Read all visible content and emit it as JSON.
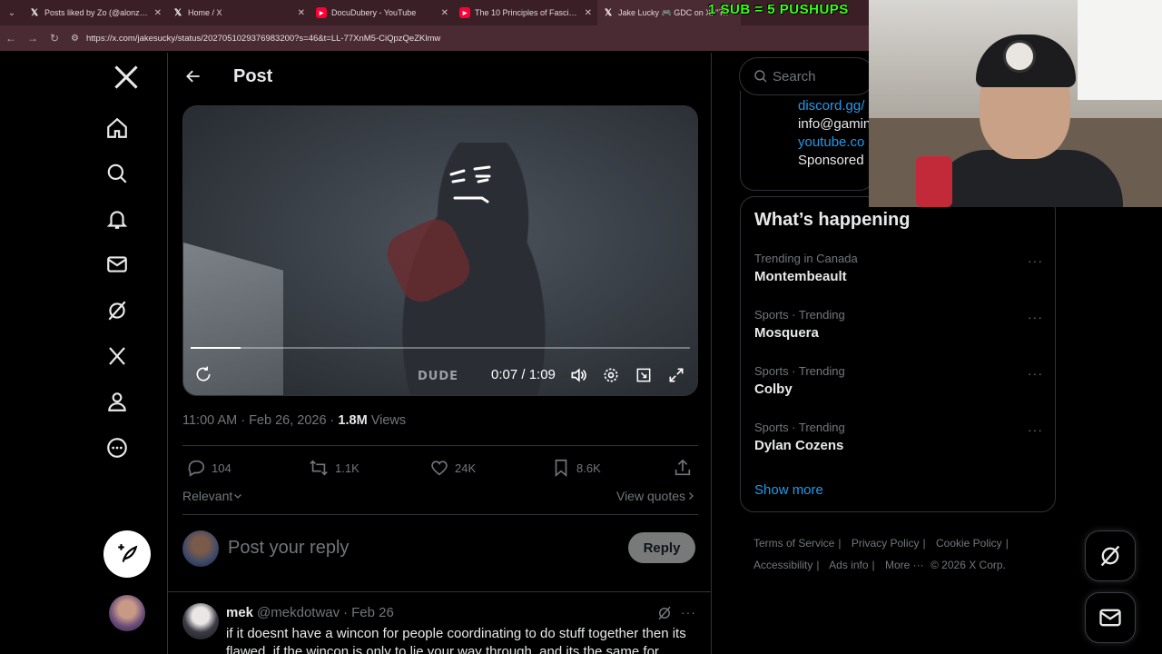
{
  "browser": {
    "tabs": [
      {
        "title": "Posts liked by Zo (@alonzonem",
        "favicon": "x-icon",
        "active": false
      },
      {
        "title": "Home / X",
        "favicon": "x-icon",
        "active": false
      },
      {
        "title": "DocuDubery - YouTube",
        "favicon": "youtube-icon",
        "active": false
      },
      {
        "title": "The 10 Principles of Fascism U",
        "favicon": "youtube-icon",
        "active": false
      },
      {
        "title": "Jake Lucky 🎮 GDC on X: \"Th",
        "favicon": "x-icon",
        "active": true
      }
    ],
    "url": "https://x.com/jakesucky/status/2027051029376983200?s=46&t=LL-77XnM5-CiQpzQeZKlmw",
    "stream_overlay": "1 SUB = 5 PUSHUPS"
  },
  "header": {
    "title": "Post"
  },
  "video": {
    "brand": "DUDE",
    "time": "0:07 / 1:09",
    "progress_fraction": 0.1
  },
  "post": {
    "meta_time": "11:00 AM · Feb 26, 2026 · ",
    "views_count": "1.8M",
    "views_label": " Views",
    "replies": "104",
    "reposts": "1.1K",
    "likes": "24K",
    "bookmarks": "8.6K",
    "sort_label": "Relevant",
    "view_quotes": "View quotes"
  },
  "reply": {
    "placeholder": "Post your reply",
    "button": "Reply"
  },
  "comment": {
    "name": "mek",
    "handle": "@mekdotwav",
    "sep": "·",
    "date": "Feb 26",
    "text": "if it doesnt have a wincon for people coordinating to do stuff together then its flawed. if the wincon is only to lie your way through, and its the same for"
  },
  "sidebar": {
    "search_placeholder": "Search",
    "promo": {
      "line1": "discord.gg/",
      "line2": "info@gamin",
      "line3": "youtube.co",
      "line4": "Sponsored"
    },
    "whats_happening": "What’s happening",
    "trends": [
      {
        "context": "Trending in Canada",
        "title": "Montembeault"
      },
      {
        "context": "Sports · Trending",
        "title": "Mosquera"
      },
      {
        "context": "Sports · Trending",
        "title": "Colby"
      },
      {
        "context": "Sports · Trending",
        "title": "Dylan Cozens"
      }
    ],
    "show_more": "Show more",
    "footer": {
      "terms": "Terms of Service",
      "privacy": "Privacy Policy",
      "cookie": "Cookie Policy",
      "accessibility": "Accessibility",
      "ads": "Ads info",
      "more": "More ···",
      "copyright": "© 2026 X Corp."
    }
  },
  "colors": {
    "accent": "#1d9bf0",
    "background": "#000000",
    "border": "#2f3336",
    "muted": "#71767b"
  }
}
